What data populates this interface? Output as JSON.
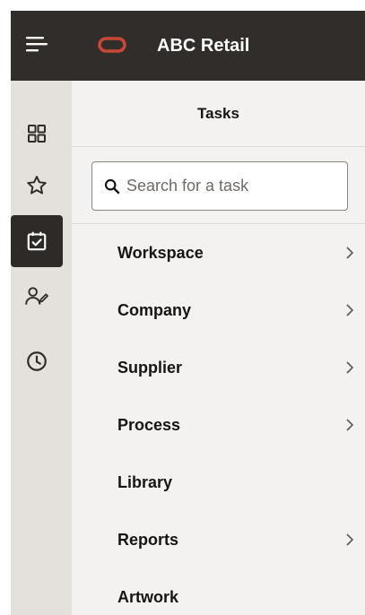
{
  "header": {
    "app_title": "ABC Retail",
    "background_color": "#312d2a",
    "logo_color": "#c74634",
    "hamburger_icon": "menu-icon"
  },
  "rail": {
    "items": [
      {
        "icon": "grid-icon",
        "active": false
      },
      {
        "icon": "star-icon",
        "active": false
      },
      {
        "icon": "calendar-check-icon",
        "active": true
      },
      {
        "icon": "users-edit-icon",
        "active": false
      },
      {
        "icon": "clock-icon",
        "active": false
      }
    ]
  },
  "panel": {
    "title": "Tasks",
    "search": {
      "placeholder": "Search for a task",
      "value": ""
    },
    "items": [
      {
        "label": "Workspace",
        "has_submenu": true
      },
      {
        "label": "Company",
        "has_submenu": true
      },
      {
        "label": "Supplier",
        "has_submenu": true
      },
      {
        "label": "Process",
        "has_submenu": true
      },
      {
        "label": "Library",
        "has_submenu": false
      },
      {
        "label": "Reports",
        "has_submenu": true
      },
      {
        "label": "Artwork",
        "has_submenu": false
      }
    ]
  }
}
